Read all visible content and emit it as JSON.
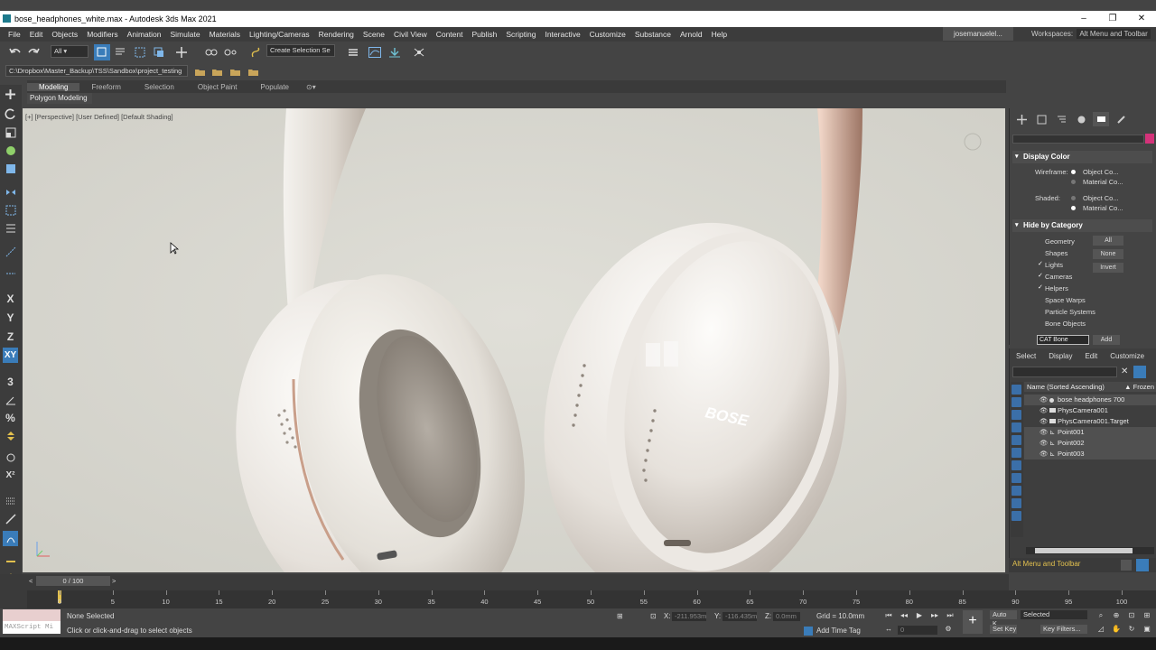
{
  "window": {
    "title": "bose_headphones_white.max - Autodesk 3ds Max 2021",
    "controls": [
      "–",
      "❐",
      "✕"
    ]
  },
  "menu": [
    "File",
    "Edit",
    "Objects",
    "Modifiers",
    "Animation",
    "Simulate",
    "Materials",
    "Lighting/Cameras",
    "Rendering",
    "Scene",
    "Civil View",
    "Content",
    "Publish",
    "Scripting",
    "Interactive",
    "Customize",
    "Substance",
    "Arnold",
    "Help"
  ],
  "user": "josemanuelel...",
  "workspaces": {
    "label": "Workspaces:",
    "value": "Alt Menu and Toolbar"
  },
  "toolbar": {
    "filter_value": "All",
    "selection_set_value": "Create Selection Se",
    "project_path": "C:\\Dropbox\\Master_Backup\\TSS\\Sandbox\\project_testing"
  },
  "ribbon": {
    "tabs": [
      "Modeling",
      "Freeform",
      "Selection",
      "Object Paint",
      "Populate"
    ],
    "active_tab": "Modeling",
    "sub": "Polygon Modeling"
  },
  "left_tools": [
    "X",
    "Y",
    "Z",
    "XY"
  ],
  "viewport": {
    "label": "[+] [Perspective] [User Defined] [Default Shading]",
    "logo_text": "BOSE"
  },
  "display_panel": {
    "display_color": {
      "title": "Display Color",
      "wireframe_label": "Wireframe:",
      "shaded_label": "Shaded:",
      "opt_object": "Object Co...",
      "opt_material": "Material Co..."
    },
    "hide_by_category": {
      "title": "Hide by Category",
      "items": [
        {
          "label": "Geometry",
          "checked": false
        },
        {
          "label": "Shapes",
          "checked": false
        },
        {
          "label": "Lights",
          "checked": true
        },
        {
          "label": "Cameras",
          "checked": true
        },
        {
          "label": "Helpers",
          "checked": true
        },
        {
          "label": "Space Warps",
          "checked": false
        },
        {
          "label": "Particle Systems",
          "checked": false
        },
        {
          "label": "Bone Objects",
          "checked": false
        }
      ],
      "btn_all": "All",
      "btn_none": "None",
      "btn_invert": "Invert",
      "cat_bone": "CAT Bone",
      "btn_add": "Add"
    }
  },
  "scene_explorer": {
    "tabs": [
      "Select",
      "Display",
      "Edit",
      "Customize"
    ],
    "col_name": "Name (Sorted Ascending)",
    "col_frozen": "▲ Frozen",
    "rows": [
      "bose headphones 700",
      "PhysCamera001",
      "PhysCamera001.Target",
      "Point001",
      "Point002",
      "Point003"
    ]
  },
  "workspace_bar": "Alt Menu and Toolbar",
  "timeline": {
    "slider": "0 / 100",
    "ticks": [
      "0",
      "5",
      "10",
      "15",
      "20",
      "25",
      "30",
      "35",
      "40",
      "45",
      "50",
      "55",
      "60",
      "65",
      "70",
      "75",
      "80",
      "85",
      "90",
      "95",
      "100"
    ]
  },
  "status": {
    "maxscript": "MAXScript Mi",
    "selection": "None Selected",
    "prompt": "Click or click-and-drag to select objects",
    "x_label": "X:",
    "x_value": "-211.953m",
    "y_label": "Y:",
    "y_value": "-116.435m",
    "z_label": "Z:",
    "z_value": "0.0mm",
    "grid": "Grid = 10.0mm",
    "add_time_tag": "Add Time Tag",
    "auto_key": "Auto K...",
    "set_key": "Set Key",
    "selected_dd": "Selected",
    "key_filters": "Key Filters...",
    "frame": "0"
  },
  "colors": {
    "accent": "#3a7cb9",
    "magenta": "#d4337a",
    "workspace_text": "#e2c04e"
  }
}
